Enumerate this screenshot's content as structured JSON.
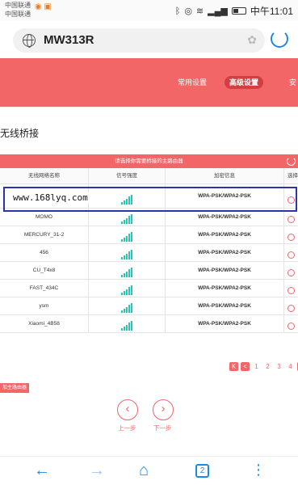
{
  "status_bar": {
    "carrier_1": "中国联通",
    "carrier_2": "中国联通",
    "time": "中午11:01"
  },
  "browser": {
    "url": "MW313R"
  },
  "nav": {
    "items": [
      "常用设置",
      "高级设置",
      "安"
    ]
  },
  "page": {
    "section_title": "无线桥接",
    "table_caption": "请选择你需要桥接的主路由器",
    "columns": [
      "无线网络名称",
      "信号强度",
      "加密信息",
      "选择"
    ],
    "rows": [
      {
        "name": "",
        "signal": 5,
        "encryption": "WPA-PSK/WPA2-PSK"
      },
      {
        "name": "MOMO",
        "signal": 5,
        "encryption": "WPA-PSK/WPA2-PSK"
      },
      {
        "name": "MERCURY_31-2",
        "signal": 5,
        "encryption": "WPA-PSK/WPA2-PSK"
      },
      {
        "name": "456",
        "signal": 5,
        "encryption": "WPA-PSK/WPA2-PSK"
      },
      {
        "name": "CU_T4x8",
        "signal": 5,
        "encryption": "WPA-PSK/WPA2-PSK"
      },
      {
        "name": "FAST_434C",
        "signal": 5,
        "encryption": "WPA-PSK/WPA2-PSK"
      },
      {
        "name": "ysm",
        "signal": 5,
        "encryption": "WPA-PSK/WPA2-PSK"
      },
      {
        "name": "Xiaomi_4B58",
        "signal": 5,
        "encryption": "WPA-PSK/WPA2-PSK"
      }
    ],
    "watermark": "www.168lyq.com",
    "pagination": {
      "first": "K",
      "prev": "<",
      "pages": [
        "1",
        "2",
        "3",
        "4"
      ],
      "next": ">"
    },
    "add_router": "加主路由器",
    "prev_step": "上一步",
    "next_step": "下一步"
  },
  "bottom_nav": {
    "tabs_count": "2"
  },
  "colors": {
    "accent": "#f26668",
    "browser_blue": "#1e88e5",
    "signal": "#2fc0b6",
    "highlight_box": "#2b33b0"
  }
}
